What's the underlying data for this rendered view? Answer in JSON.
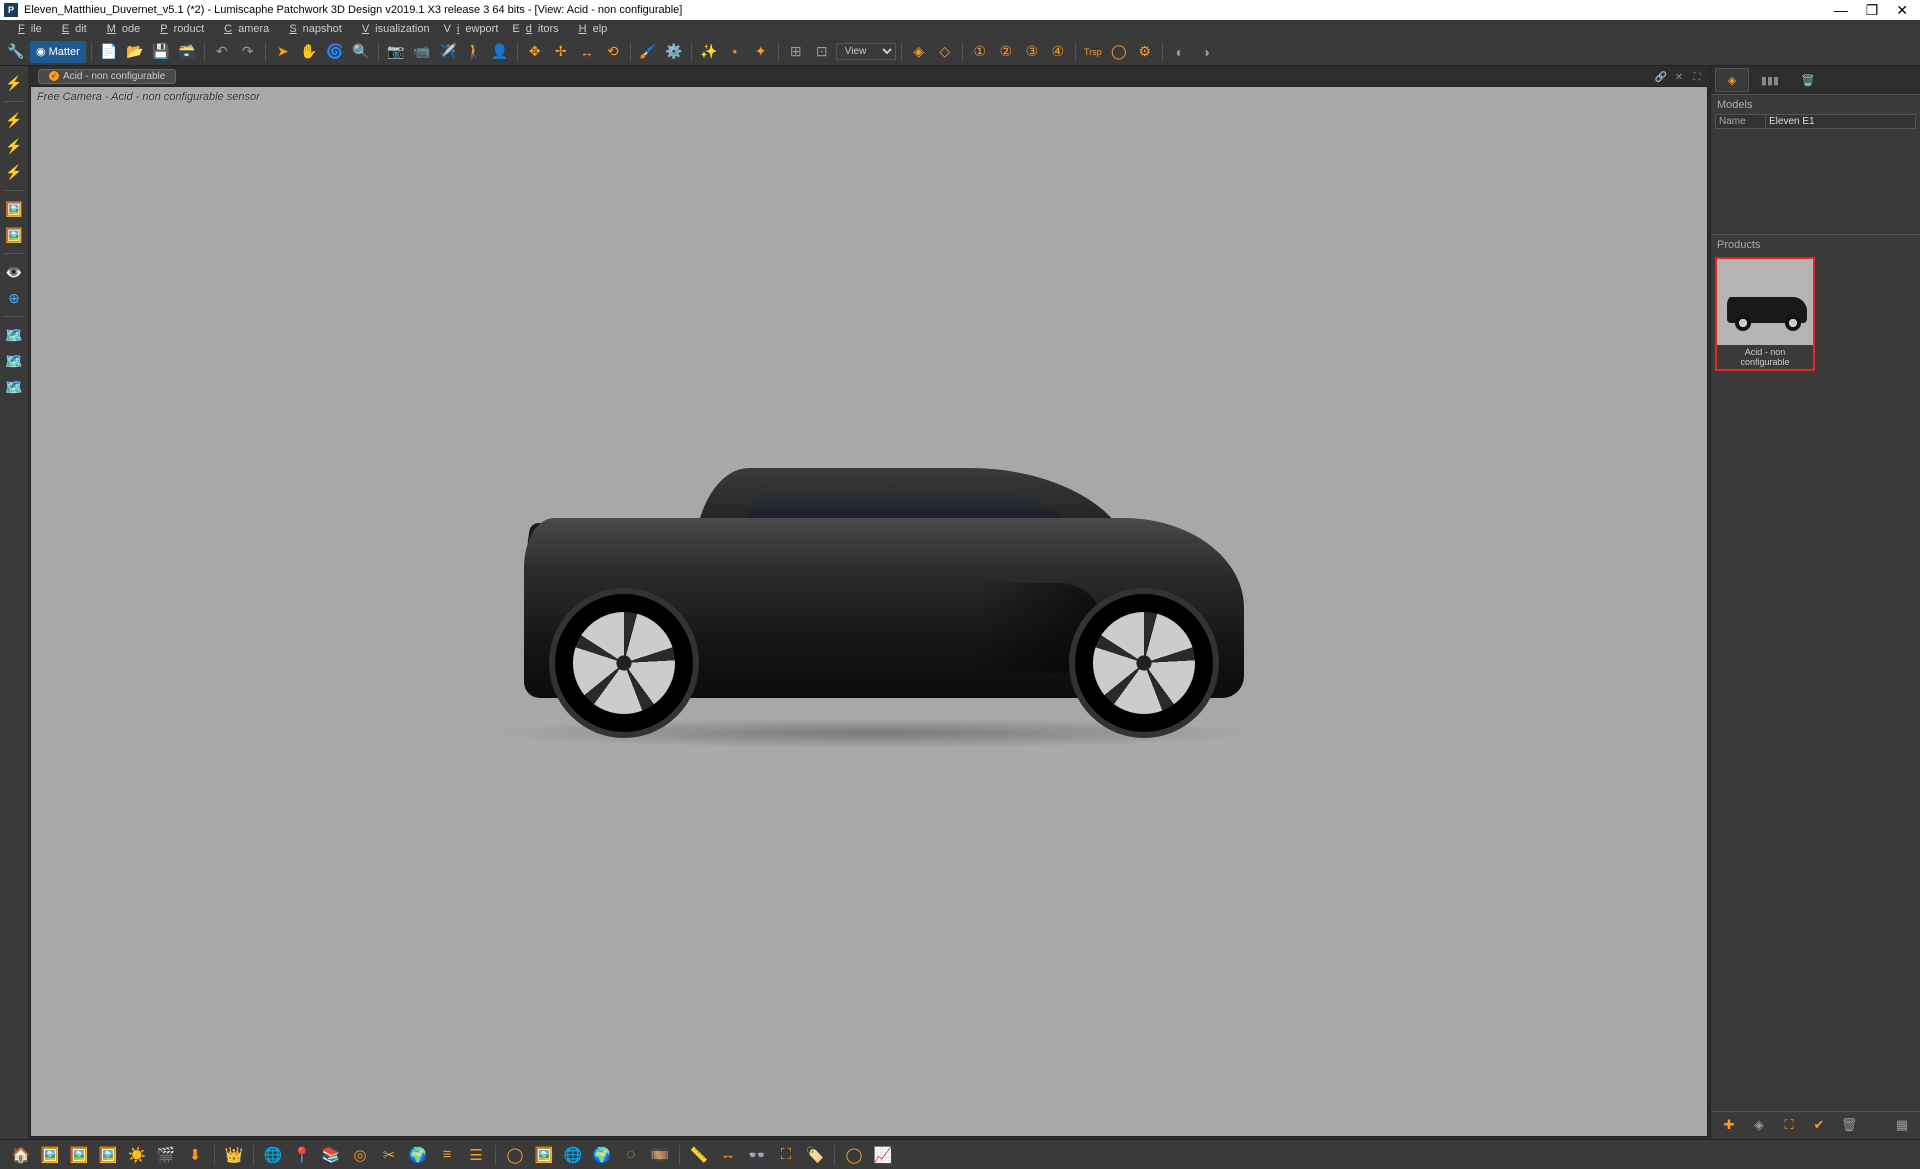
{
  "titlebar": {
    "icon_text": "P",
    "title": "Eleven_Matthieu_Duvernet_v5.1 (*2) - Lumiscaphe Patchwork 3D Design v2019.1 X3 release 3  64 bits - [View: Acid - non configurable]"
  },
  "menu": {
    "file": "File",
    "edit": "Edit",
    "mode": "Mode",
    "product": "Product",
    "camera": "Camera",
    "snapshot": "Snapshot",
    "visualization": "Visualization",
    "viewport": "Viewport",
    "editors": "Editors",
    "help": "Help"
  },
  "toolbar": {
    "matter_label": "Matter",
    "view_label": "View",
    "trsp_label": "Trsp"
  },
  "viewport": {
    "tab_label": "Acid - non configurable",
    "overlay_label": "Free Camera - Acid - non configurable sensor"
  },
  "right_panel": {
    "models_header": "Models",
    "name_label": "Name",
    "model_name_value": "Eleven E1",
    "products_header": "Products",
    "product_thumb_label": "Acid - non configurable"
  }
}
